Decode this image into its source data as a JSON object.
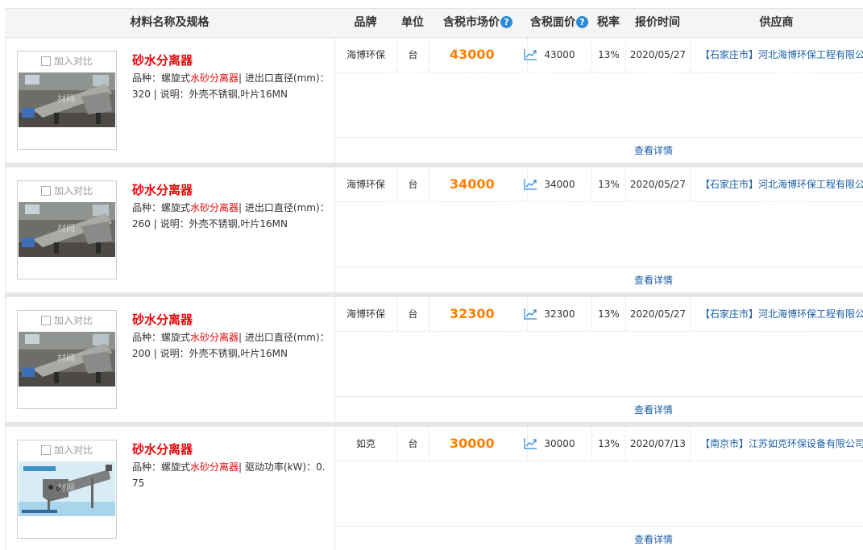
{
  "header": {
    "name_spec": "材料名称及规格",
    "brand": "品牌",
    "unit": "单位",
    "market_price": "含税市场价",
    "face_price": "含税面价",
    "tax_rate": "税率",
    "quote_time": "报价时间",
    "supplier": "供应商",
    "help_glyph": "?"
  },
  "colors": {
    "accent_price": "#ff7f00",
    "title_red": "#e10b0b",
    "link_blue": "#1a5fa8",
    "help_blue": "#2c8bd9"
  },
  "rows": [
    {
      "compare_label": "加入对比",
      "watermark": "材网",
      "title": "砂水分离器",
      "spec_prefix": "品种：螺旋式",
      "spec_type": "水砂分离器",
      "spec_suffix": "| 进出口直径(mm)：320 | 说明：外壳不锈钢,叶片16MN",
      "brand": "海博环保",
      "unit": "台",
      "market_price": "43000",
      "face_price": "43000",
      "tax_rate": "13%",
      "quote_time": "2020/05/27",
      "supplier": "【石家庄市】河北海博环保工程有限公司",
      "detail_label": "查看详情"
    },
    {
      "compare_label": "加入对比",
      "watermark": "材网",
      "title": "砂水分离器",
      "spec_prefix": "品种：螺旋式",
      "spec_type": "水砂分离器",
      "spec_suffix": "| 进出口直径(mm)：260 | 说明：外壳不锈钢,叶片16MN",
      "brand": "海博环保",
      "unit": "台",
      "market_price": "34000",
      "face_price": "34000",
      "tax_rate": "13%",
      "quote_time": "2020/05/27",
      "supplier": "【石家庄市】河北海博环保工程有限公司",
      "detail_label": "查看详情"
    },
    {
      "compare_label": "加入对比",
      "watermark": "材网",
      "title": "砂水分离器",
      "spec_prefix": "品种：螺旋式",
      "spec_type": "水砂分离器",
      "spec_suffix": "| 进出口直径(mm)：200 | 说明：外壳不锈钢,叶片16MN",
      "brand": "海博环保",
      "unit": "台",
      "market_price": "32300",
      "face_price": "32300",
      "tax_rate": "13%",
      "quote_time": "2020/05/27",
      "supplier": "【石家庄市】河北海博环保工程有限公司",
      "detail_label": "查看详情"
    },
    {
      "compare_label": "加入对比",
      "watermark": "材网",
      "title": "砂水分离器",
      "spec_prefix": "品种：螺旋式",
      "spec_type": "水砂分离器",
      "spec_suffix": "| 驱动功率(kW)：0.75",
      "brand": "如克",
      "unit": "台",
      "market_price": "30000",
      "face_price": "30000",
      "tax_rate": "13%",
      "quote_time": "2020/07/13",
      "supplier": "【南京市】江苏如克环保设备有限公司",
      "detail_label": "查看详情"
    }
  ]
}
